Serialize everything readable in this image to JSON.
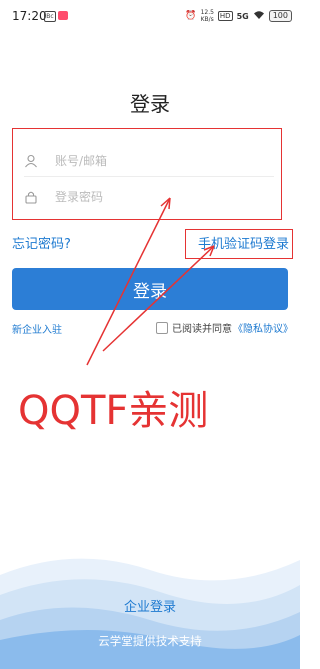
{
  "status_bar": {
    "time": "17:20",
    "badge_text": "Bc",
    "network_speed": "12.5",
    "network_unit": "KB/s",
    "network_type": "HD",
    "signal": "5G",
    "battery": "100"
  },
  "page": {
    "title": "登录"
  },
  "form": {
    "account_placeholder": "账号/邮箱",
    "password_placeholder": "登录密码",
    "user_icon": "user-icon",
    "lock_icon": "lock-icon"
  },
  "links": {
    "forgot_password": "忘记密码?",
    "phone_login": "手机验证码登录",
    "new_company": "新企业入驻",
    "agreement_prefix": "已阅读并同意",
    "privacy": "《隐私协议》"
  },
  "login_button": {
    "label": "登录"
  },
  "annotation": {
    "watermark_text": "QQTF亲测",
    "color": "#e53333"
  },
  "footer": {
    "company_login": "企业登录",
    "provider": "云学堂提供技术支持"
  },
  "colors": {
    "primary": "#2c7ed6",
    "link": "#1e7ad0"
  }
}
